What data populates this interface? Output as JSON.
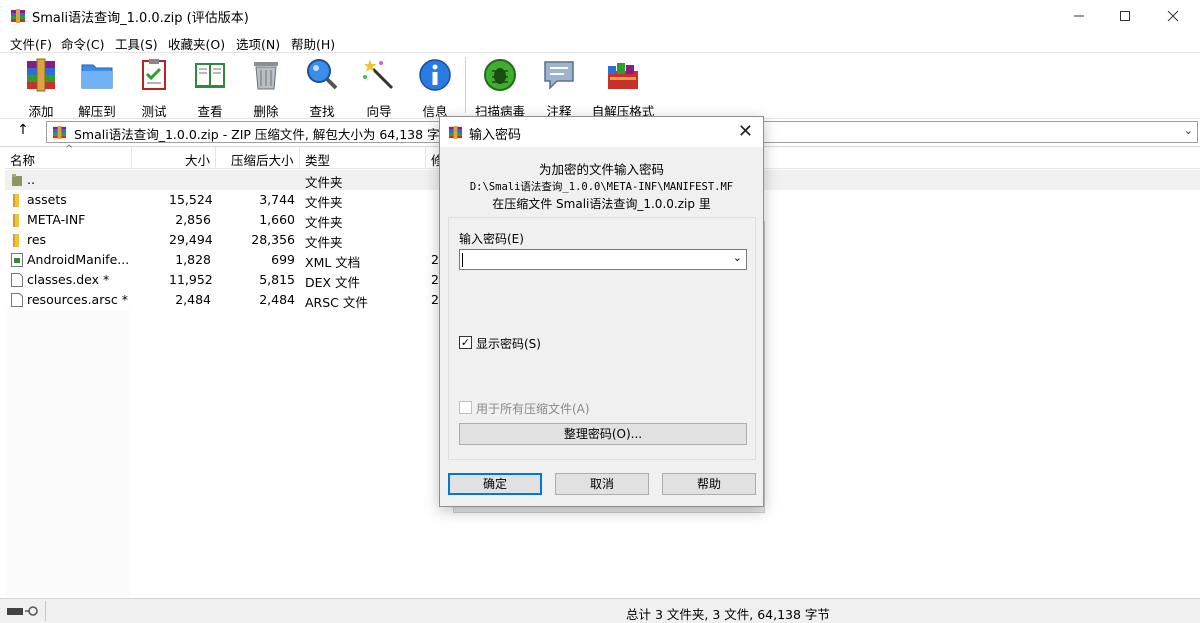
{
  "window": {
    "title": "Smali语法查询_1.0.0.zip (评估版本)",
    "app_icon": "winrar-icon",
    "controls": [
      "minimize-icon",
      "maximize-icon",
      "close-icon"
    ]
  },
  "menu": [
    "文件(F)",
    "命令(C)",
    "工具(S)",
    "收藏夹(O)",
    "选项(N)",
    "帮助(H)"
  ],
  "toolbar": [
    {
      "label": "添加",
      "icon": "add-archive-icon"
    },
    {
      "label": "解压到",
      "icon": "extract-folder-icon"
    },
    {
      "label": "测试",
      "icon": "test-clipboard-icon"
    },
    {
      "label": "查看",
      "icon": "view-book-icon"
    },
    {
      "label": "删除",
      "icon": "trash-icon"
    },
    {
      "label": "查找",
      "icon": "magnifier-icon"
    },
    {
      "label": "向导",
      "icon": "wizard-wand-icon"
    },
    {
      "label": "信息",
      "icon": "info-icon"
    },
    {
      "label": "扫描病毒",
      "icon": "virus-scan-icon"
    },
    {
      "label": "注释",
      "icon": "comment-icon"
    },
    {
      "label": "自解压格式",
      "icon": "sfx-books-icon"
    }
  ],
  "address": {
    "text": "Smali语法查询_1.0.0.zip - ZIP 压缩文件, 解包大小为 64,138 字节"
  },
  "columns": [
    "名称",
    "大小",
    "压缩后大小",
    "类型",
    "修"
  ],
  "files": [
    {
      "name": "..",
      "size": "",
      "packed": "",
      "type": "文件夹",
      "mod": "",
      "icon": "parent-folder-icon"
    },
    {
      "name": "assets",
      "size": "15,524",
      "packed": "3,744",
      "type": "文件夹",
      "mod": "",
      "icon": "folder-icon"
    },
    {
      "name": "META-INF",
      "size": "2,856",
      "packed": "1,660",
      "type": "文件夹",
      "mod": "",
      "icon": "folder-icon"
    },
    {
      "name": "res",
      "size": "29,494",
      "packed": "28,356",
      "type": "文件夹",
      "mod": "",
      "icon": "folder-icon"
    },
    {
      "name": "AndroidManife...",
      "size": "1,828",
      "packed": "699",
      "type": "XML 文档",
      "mod": "2",
      "icon": "xml-file-icon"
    },
    {
      "name": "classes.dex *",
      "size": "11,952",
      "packed": "5,815",
      "type": "DEX 文件",
      "mod": "2",
      "icon": "file-icon"
    },
    {
      "name": "resources.arsc *",
      "size": "2,484",
      "packed": "2,484",
      "type": "ARSC 文件",
      "mod": "2",
      "icon": "file-icon"
    }
  ],
  "status": {
    "summary": "总计 3 文件夹, 3 文件, 64,138 字节"
  },
  "dialog": {
    "title": "输入密码",
    "info_line1": "为加密的文件输入密码",
    "info_line2": "D:\\Smali语法查询_1.0.0\\META-INF\\MANIFEST.MF",
    "info_line3": "在压缩文件 Smali语法查询_1.0.0.zip 里",
    "password_label": "输入密码(E)",
    "password_value": "",
    "show_password_label": "显示密码(S)",
    "show_password_checked": true,
    "use_for_all_label": "用于所有压缩文件(A)",
    "use_for_all_checked": false,
    "manage_button": "整理密码(O)...",
    "ok_button": "确定",
    "cancel_button": "取消",
    "help_button": "帮助"
  }
}
